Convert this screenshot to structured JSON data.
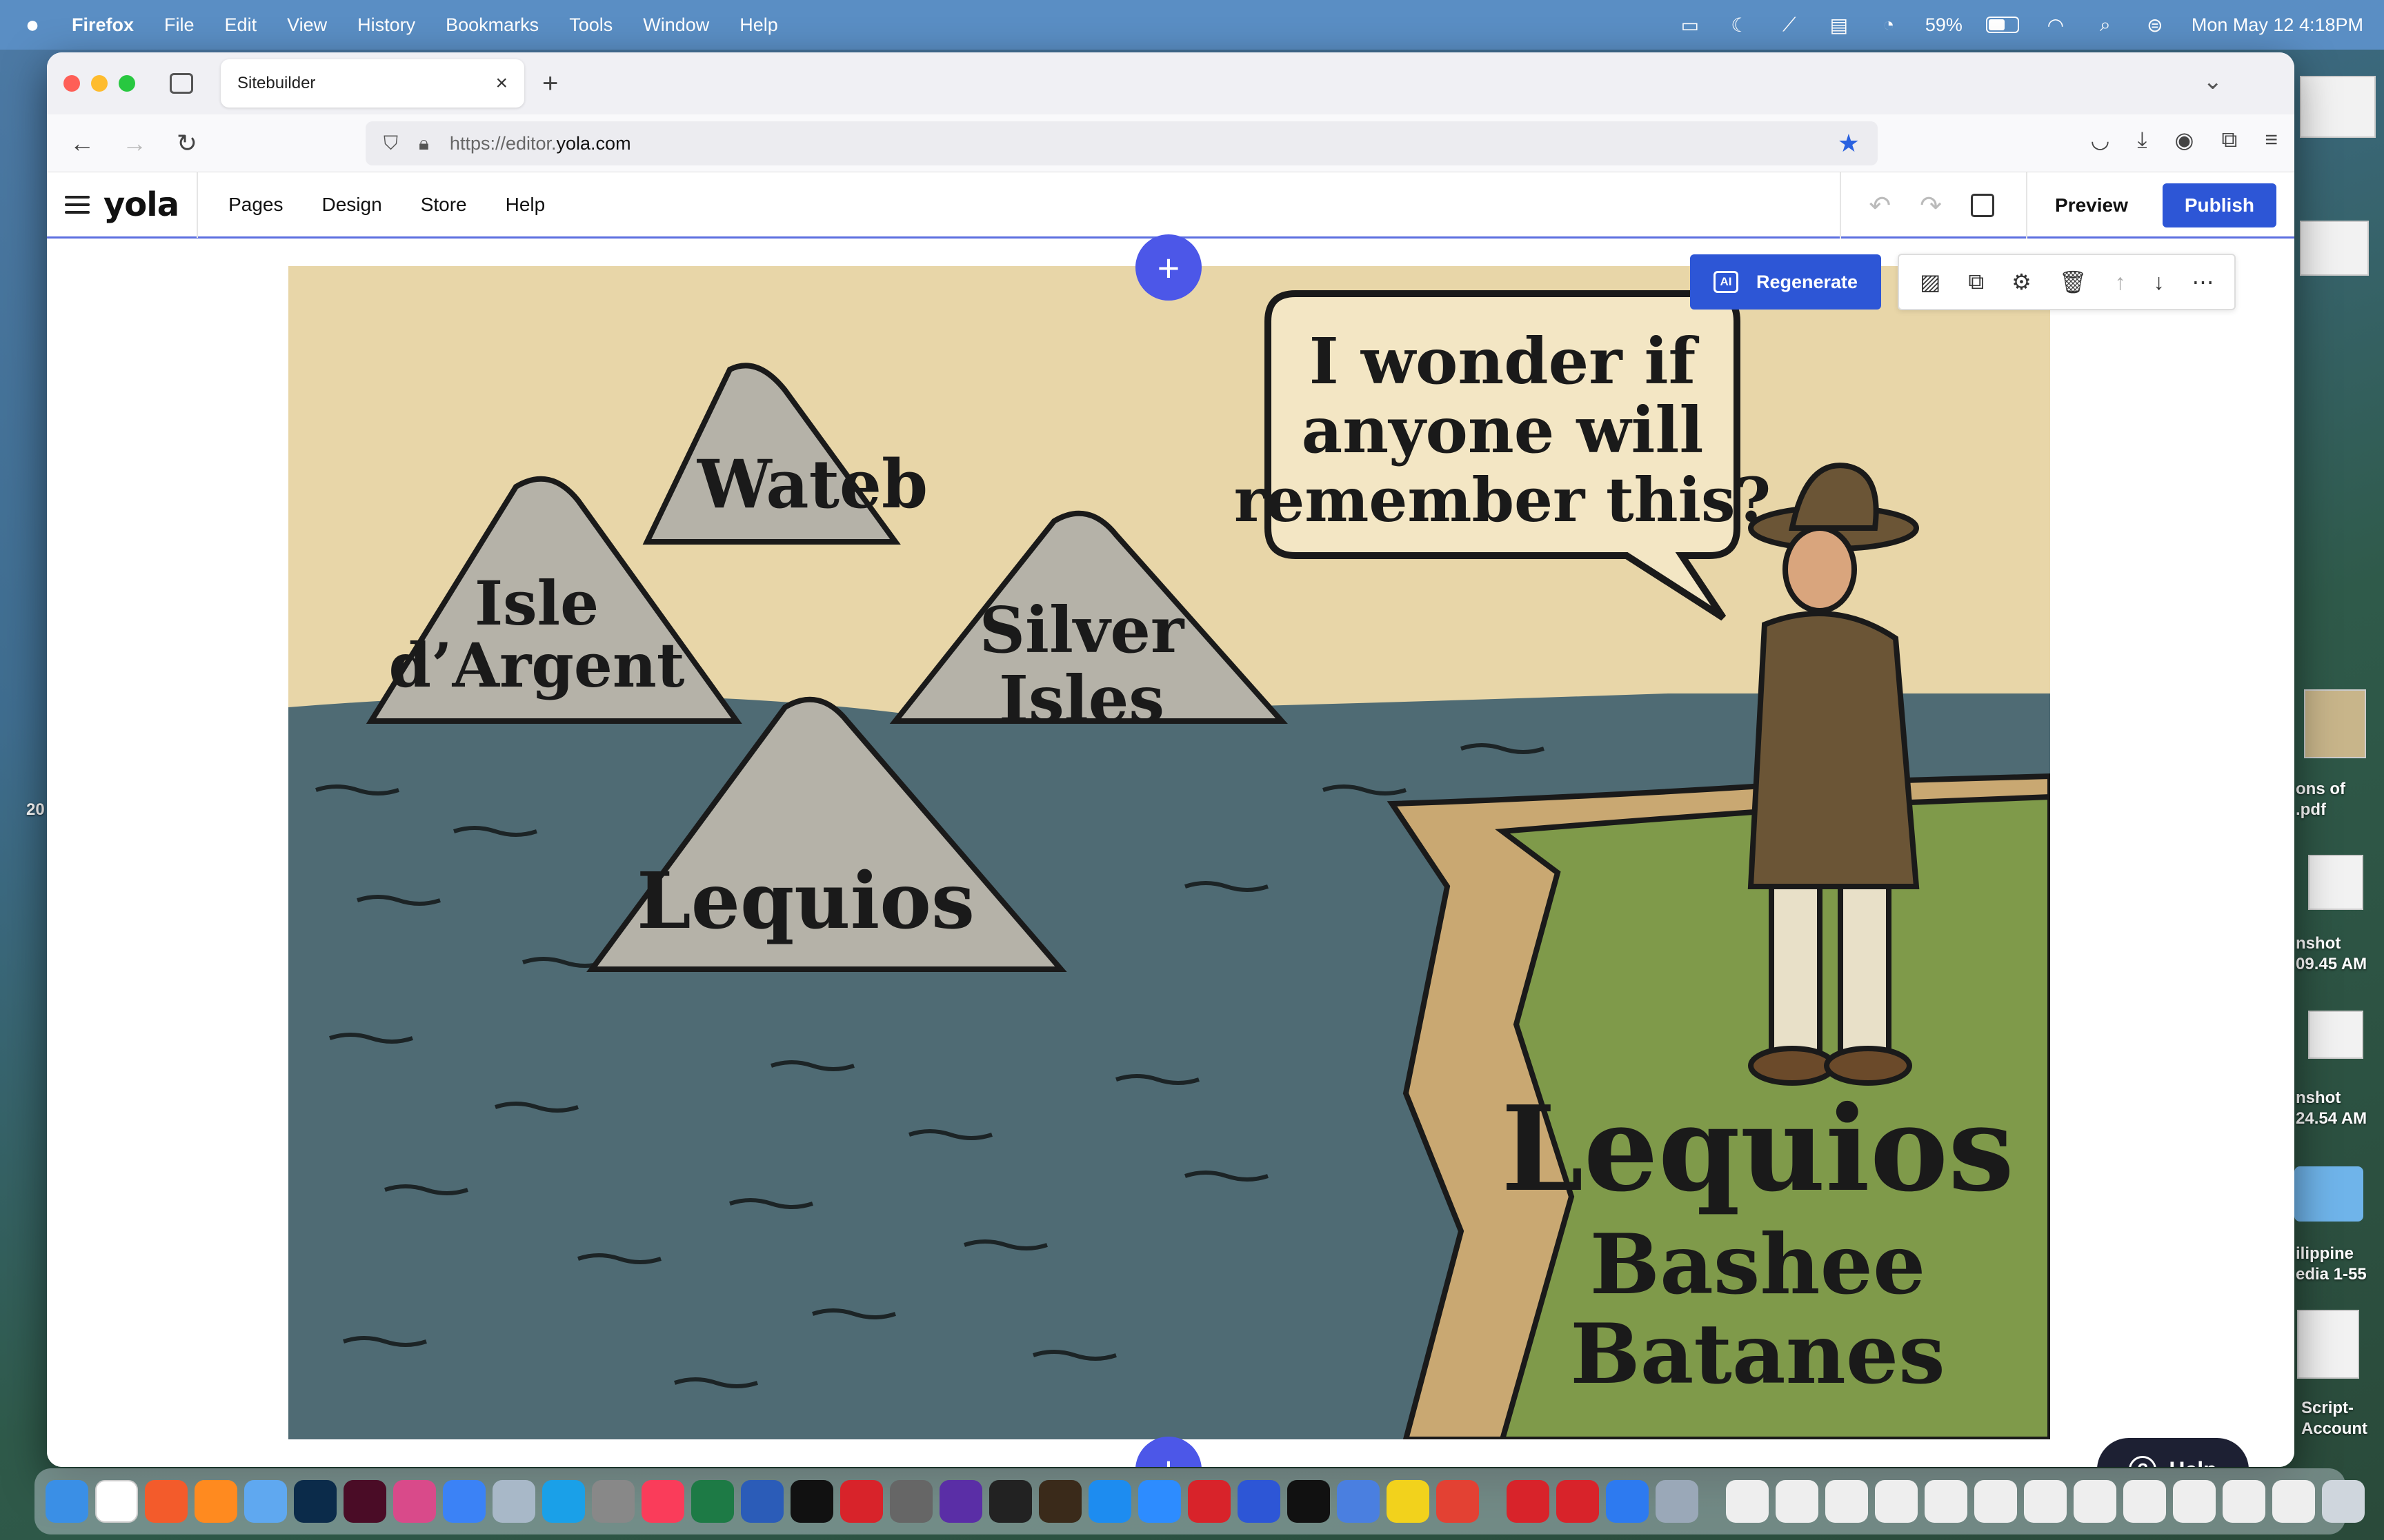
{
  "menubar": {
    "app": "Firefox",
    "items": [
      "File",
      "Edit",
      "View",
      "History",
      "Bookmarks",
      "Tools",
      "Window",
      "Help"
    ],
    "battery_label": "59%",
    "battery_level": 0.59,
    "datetime": "Mon May 12  4:18PM"
  },
  "browser": {
    "tab_title": "Sitebuilder",
    "url_prefix": "https://editor.",
    "url_host": "yola.com"
  },
  "editor": {
    "logo": "yola",
    "menu": [
      "Pages",
      "Design",
      "Store",
      "Help"
    ],
    "preview_label": "Preview",
    "publish_label": "Publish",
    "regenerate_label": "Regenerate",
    "ai_badge": "AI",
    "help_label": "Help"
  },
  "illustration": {
    "speech_bubble": [
      "I wonder if",
      "anyone will",
      "remember this?"
    ],
    "islands": {
      "wateb": "Wateb",
      "isle_line1": "Isle",
      "isle_line2": "d’Argent",
      "silver_line1": "Silver",
      "silver_line2": "Isles",
      "lequios": "Lequios"
    },
    "cliff_labels": [
      "Lequios",
      "Bashee",
      "Batanes"
    ]
  },
  "desktop": {
    "labels": [
      "nshot",
      "09.45 AM",
      "nshot",
      "24.54 AM",
      "ilippine",
      "edia 1-55",
      "Script-",
      "Account",
      "ons of",
      ".pdf",
      "20"
    ]
  },
  "colors": {
    "accent": "#2d56d6",
    "plus": "#4c57e8",
    "sea": "#4f6b74",
    "parchment": "#e6d3a6",
    "grass": "#7f9a4a"
  }
}
